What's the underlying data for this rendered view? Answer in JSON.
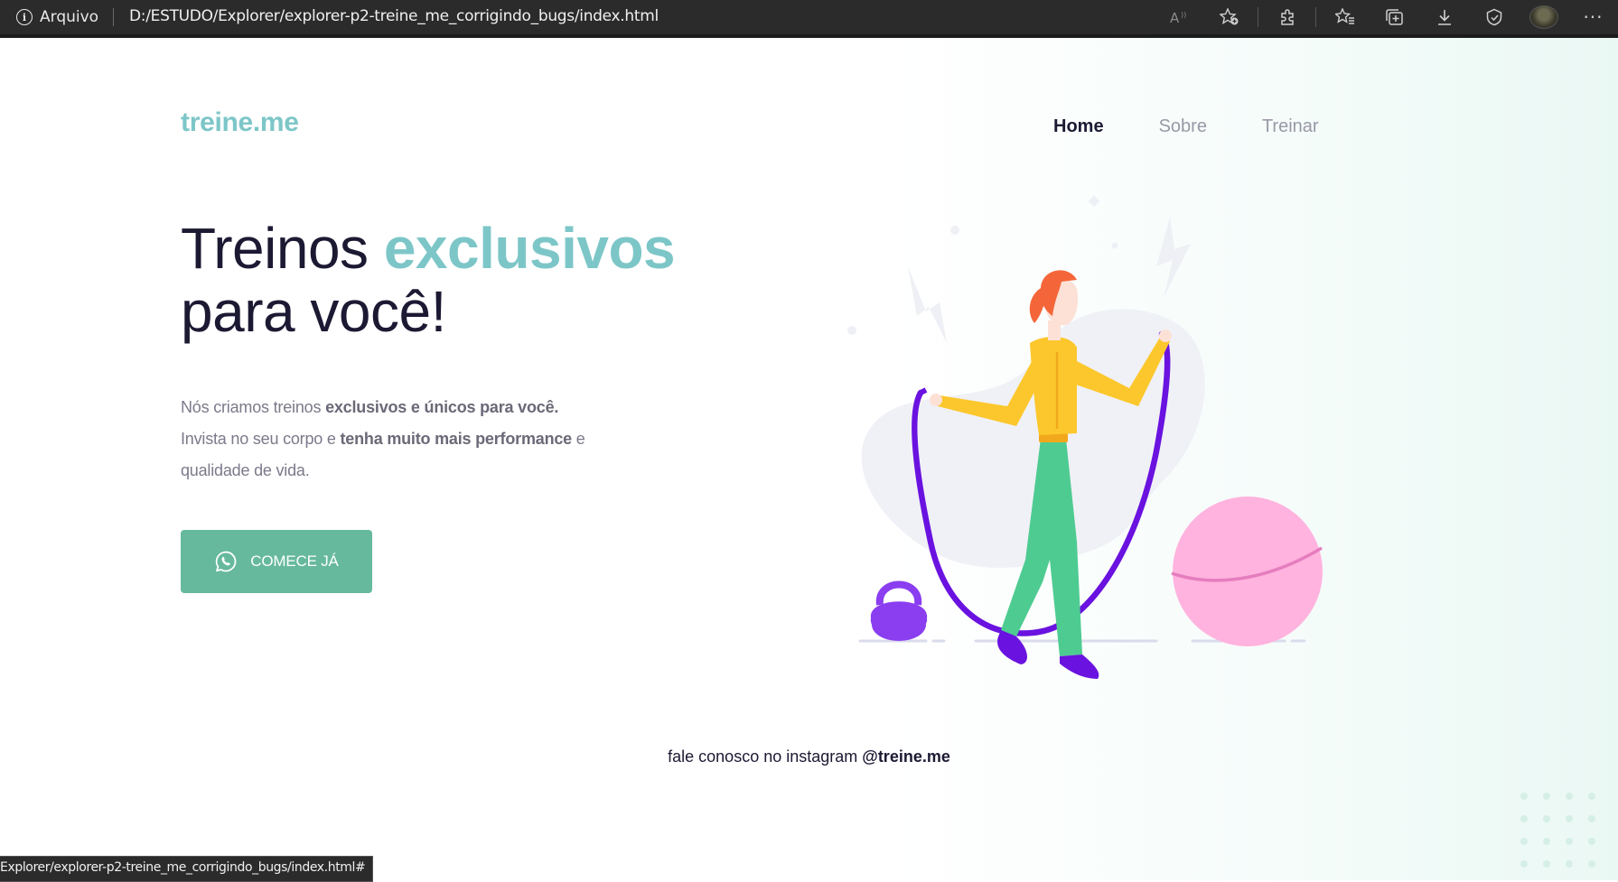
{
  "browser": {
    "site_label": "Arquivo",
    "address": "D:/ESTUDO/Explorer/explorer-p2-treine_me_corrigindo_bugs/index.html",
    "status_url": "Explorer/explorer-p2-treine_me_corrigindo_bugs/index.html#",
    "toolbar_icons": [
      "read-aloud-icon",
      "add-favorite-icon",
      "extensions-icon",
      "favorites-icon",
      "collections-icon",
      "downloads-icon",
      "browser-essentials-icon",
      "profile-avatar",
      "more-icon"
    ]
  },
  "header": {
    "logo": "treine.me",
    "nav": [
      {
        "label": "Home",
        "active": true
      },
      {
        "label": "Sobre",
        "active": false
      },
      {
        "label": "Treinar",
        "active": false
      }
    ]
  },
  "hero": {
    "title_part1": "Treinos ",
    "title_accent": "exclusivos",
    "title_part2": "para você!",
    "text_1": "Nós criamos treinos ",
    "text_1_bold": "exclusivos e únicos para você.",
    "text_2": "Invista no seu corpo e ",
    "text_2_bold": "tenha muito mais performance",
    "text_3": " e qualidade de vida.",
    "cta_label": "COMECE JÁ",
    "cta_icon": "whatsapp-icon"
  },
  "footer": {
    "text": "fale conosco no instagram ",
    "handle": "@treine.me"
  },
  "colors": {
    "accent": "#7dc6c8",
    "cta": "#66b99d",
    "title": "#1c1933",
    "text": "#7b7a8a"
  }
}
